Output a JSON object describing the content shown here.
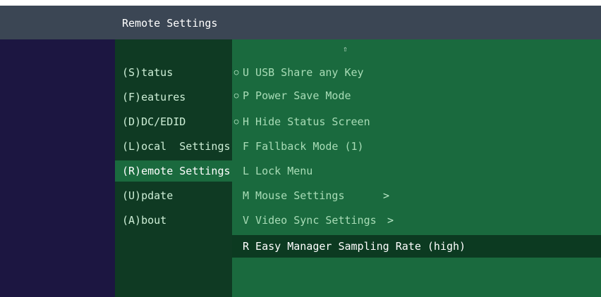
{
  "window": {
    "title": "Remote Settings"
  },
  "menu": {
    "items": [
      {
        "label": "(S)tatus"
      },
      {
        "label": "(F)eatures"
      },
      {
        "label": "(D)DC/EDID"
      },
      {
        "label": "(L)ocal  Settings"
      },
      {
        "label": "(R)emote Settings",
        "active": true
      },
      {
        "label": "(U)pdate"
      },
      {
        "label": "(A)bout"
      }
    ]
  },
  "submenu": {
    "scroll_up_icon": "up-arrow-icon",
    "scroll_up_glyph": "⇧",
    "items": [
      {
        "bullet": "○",
        "label": "U USB Share any Key"
      },
      {
        "bullet": "○",
        "label": "P Power Save Mode"
      },
      {
        "bullet": "○",
        "label": "H Hide Status Screen"
      },
      {
        "bullet": "",
        "label": "F Fallback Mode (1)"
      },
      {
        "bullet": "",
        "label": "L Lock Menu"
      },
      {
        "bullet": "",
        "label": "M Mouse Settings",
        "chevron": ">"
      },
      {
        "bullet": "",
        "label": "V Video Sync Settings",
        "chevron": ">"
      },
      {
        "bullet": "",
        "label": "R Easy Manager Sampling Rate (high)",
        "highlighted": true
      }
    ]
  },
  "colors": {
    "titlebar": "#3b4654",
    "left_strip": "#1c1641",
    "menu_background": "#0f3a23",
    "submenu_background": "#1a6a3e",
    "highlight": "#0c3a21"
  }
}
